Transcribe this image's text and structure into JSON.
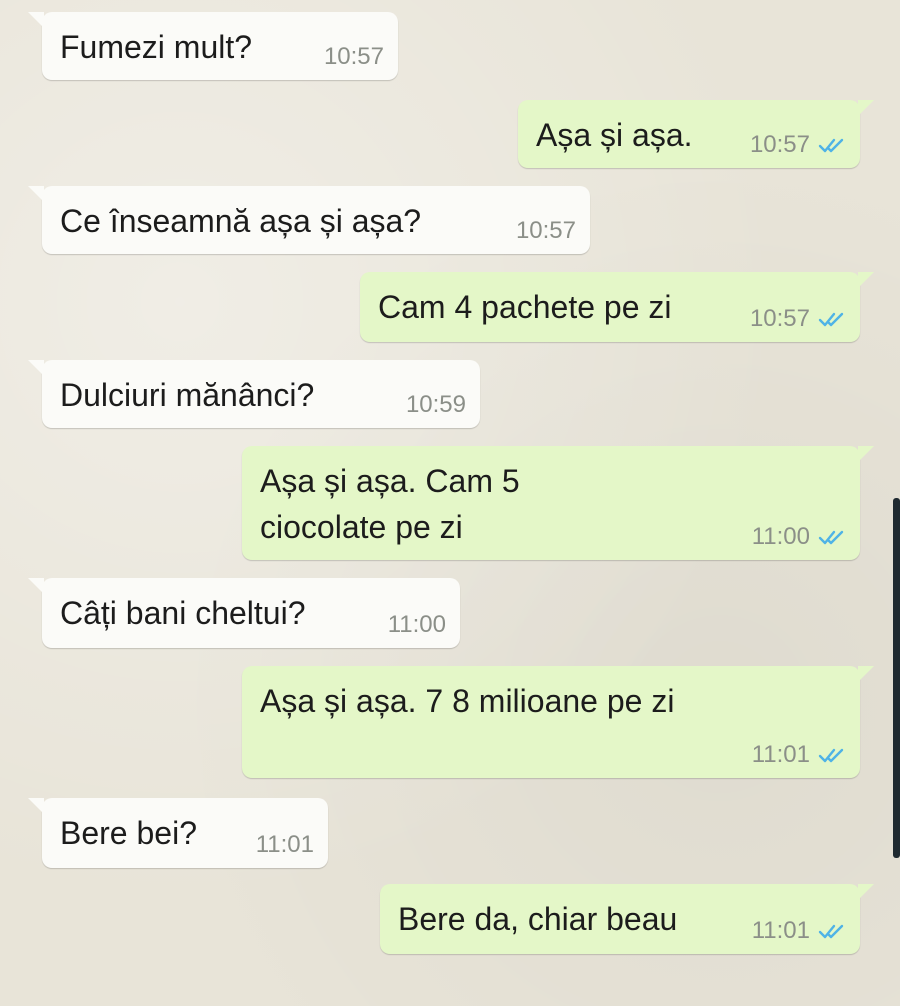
{
  "messages": [
    {
      "side": "in",
      "text": "Fumezi mult?",
      "time": "10:57"
    },
    {
      "side": "out",
      "text": "Așa și așa.",
      "time": "10:57",
      "ticks": "double-check-icon"
    },
    {
      "side": "in",
      "text": "Ce înseamnă așa și așa?",
      "time": "10:57"
    },
    {
      "side": "out",
      "text": "Cam 4 pachete pe zi",
      "time": "10:57",
      "ticks": "double-check-icon"
    },
    {
      "side": "in",
      "text": "Dulciuri mănânci?",
      "time": "10:59"
    },
    {
      "side": "out",
      "text": "Așa și așa. Cam 5 ciocolate pe zi",
      "time": "11:00",
      "ticks": "double-check-icon"
    },
    {
      "side": "in",
      "text": "Câți bani cheltui?",
      "time": "11:00"
    },
    {
      "side": "out",
      "text": "Așa și așa. 7 8 milioane pe zi",
      "time": "11:01",
      "ticks": "double-check-icon"
    },
    {
      "side": "in",
      "text": "Bere bei?",
      "time": "11:01"
    },
    {
      "side": "out",
      "text": "Bere da, chiar beau",
      "time": "11:01",
      "ticks": "double-check-icon"
    }
  ],
  "colors": {
    "incoming_bubble": "#fbfbf8",
    "outgoing_bubble": "#e4f7c8",
    "read_ticks": "#4fb3e6",
    "timestamp": "#8b8f88"
  }
}
